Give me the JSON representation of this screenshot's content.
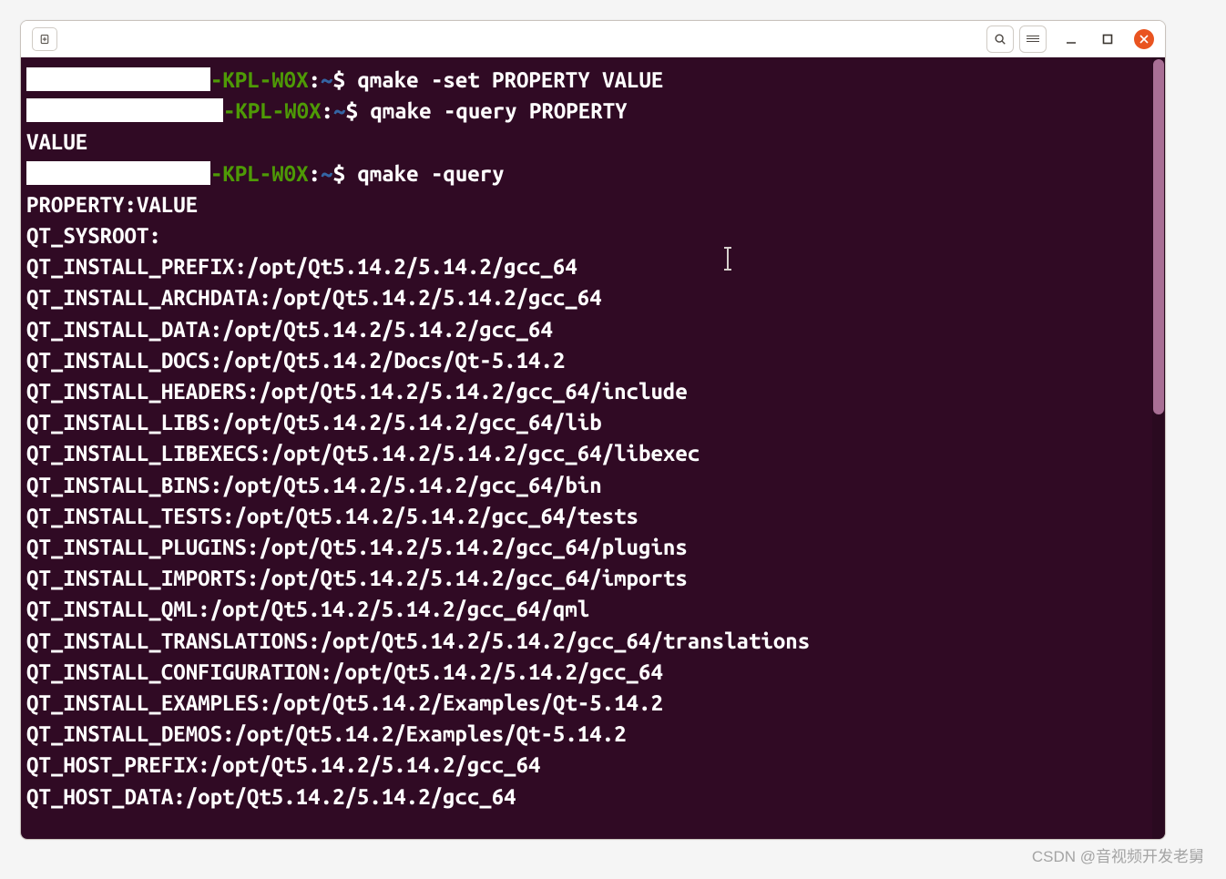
{
  "titlebar": {
    "new_tab": "⊕"
  },
  "prompt": {
    "host_suffix": "-KPL-W0X",
    "separator": ":",
    "path": "~",
    "sigil": "$"
  },
  "commands": {
    "cmd1": " qmake -set PROPERTY VALUE",
    "cmd2": " qmake -query PROPERTY",
    "cmd2_out": "VALUE",
    "cmd3": " qmake -query"
  },
  "query_output": [
    "PROPERTY:VALUE",
    "QT_SYSROOT:",
    "QT_INSTALL_PREFIX:/opt/Qt5.14.2/5.14.2/gcc_64",
    "QT_INSTALL_ARCHDATA:/opt/Qt5.14.2/5.14.2/gcc_64",
    "QT_INSTALL_DATA:/opt/Qt5.14.2/5.14.2/gcc_64",
    "QT_INSTALL_DOCS:/opt/Qt5.14.2/Docs/Qt-5.14.2",
    "QT_INSTALL_HEADERS:/opt/Qt5.14.2/5.14.2/gcc_64/include",
    "QT_INSTALL_LIBS:/opt/Qt5.14.2/5.14.2/gcc_64/lib",
    "QT_INSTALL_LIBEXECS:/opt/Qt5.14.2/5.14.2/gcc_64/libexec",
    "QT_INSTALL_BINS:/opt/Qt5.14.2/5.14.2/gcc_64/bin",
    "QT_INSTALL_TESTS:/opt/Qt5.14.2/5.14.2/gcc_64/tests",
    "QT_INSTALL_PLUGINS:/opt/Qt5.14.2/5.14.2/gcc_64/plugins",
    "QT_INSTALL_IMPORTS:/opt/Qt5.14.2/5.14.2/gcc_64/imports",
    "QT_INSTALL_QML:/opt/Qt5.14.2/5.14.2/gcc_64/qml",
    "QT_INSTALL_TRANSLATIONS:/opt/Qt5.14.2/5.14.2/gcc_64/translations",
    "QT_INSTALL_CONFIGURATION:/opt/Qt5.14.2/5.14.2/gcc_64",
    "QT_INSTALL_EXAMPLES:/opt/Qt5.14.2/Examples/Qt-5.14.2",
    "QT_INSTALL_DEMOS:/opt/Qt5.14.2/Examples/Qt-5.14.2",
    "QT_HOST_PREFIX:/opt/Qt5.14.2/5.14.2/gcc_64",
    "QT_HOST_DATA:/opt/Qt5.14.2/5.14.2/gcc_64"
  ],
  "watermark": "CSDN @音视频开发老舅"
}
